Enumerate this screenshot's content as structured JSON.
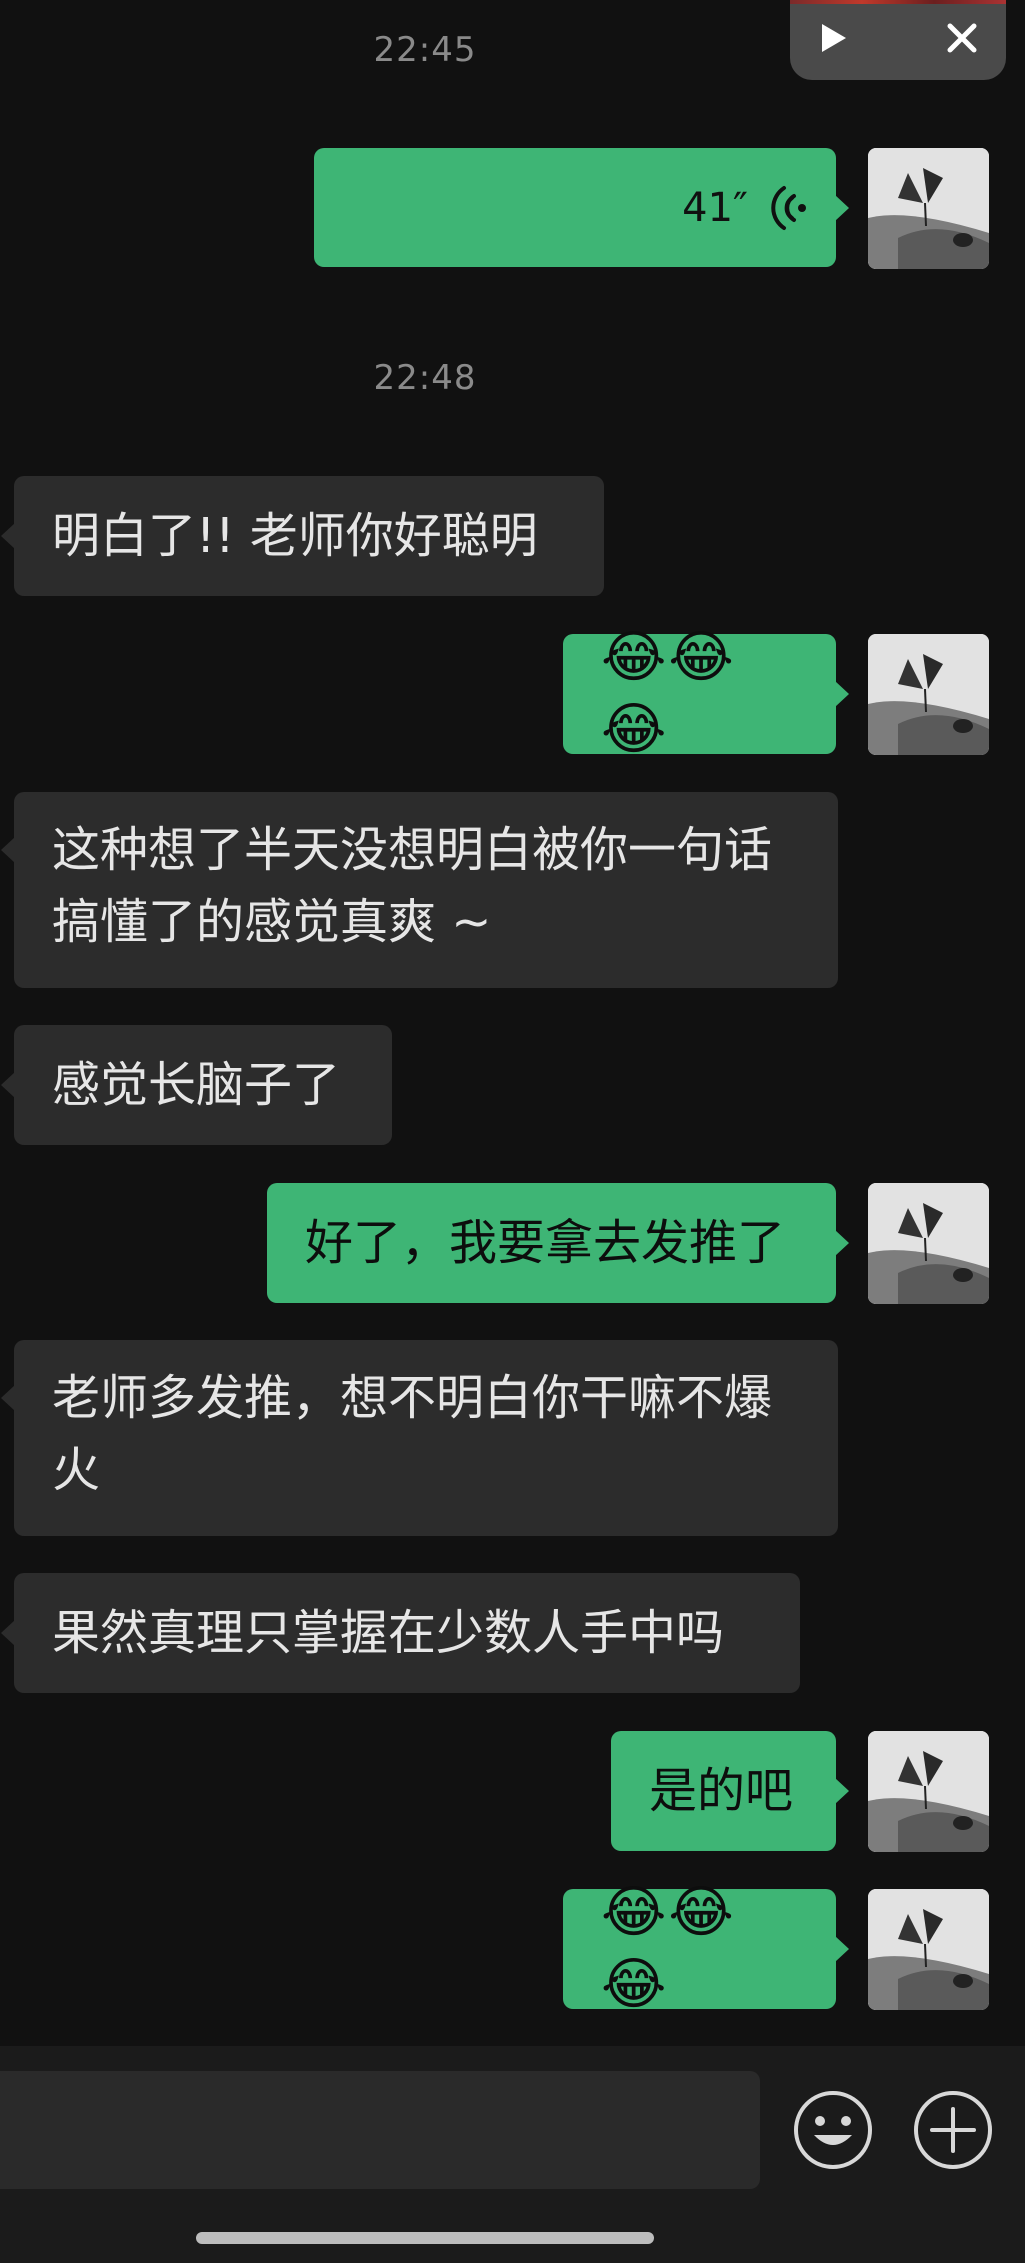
{
  "floating_window": {
    "play_icon": "play-icon",
    "close_icon": "close-icon"
  },
  "timestamps": [
    "22:45",
    "22:48"
  ],
  "messages": [
    {
      "side": "out",
      "type": "voice",
      "duration": "41″"
    },
    {
      "side": "in",
      "text": "明白了!! 老师你好聪明"
    },
    {
      "side": "out",
      "text": "😂😂😂"
    },
    {
      "side": "in",
      "text": "这种想了半天没想明白被你一句话搞懂了的感觉真爽 ~"
    },
    {
      "side": "in",
      "text": "感觉长脑子了"
    },
    {
      "side": "out",
      "text": "好了，我要拿去发推了"
    },
    {
      "side": "in",
      "text": "老师多发推，想不明白你干嘛不爆火"
    },
    {
      "side": "in",
      "text": "果然真理只掌握在少数人手中吗"
    },
    {
      "side": "out",
      "text": "是的吧"
    },
    {
      "side": "out",
      "text": "😂😂😂"
    }
  ],
  "avatar": {
    "icon": "cat-butterfly-avatar"
  },
  "bottom_bar": {
    "input_value": "",
    "emoji_icon": "emoji-icon",
    "plus_icon": "plus-icon"
  },
  "colors": {
    "background": "#111111",
    "incoming_bubble": "#2c2c2c",
    "outgoing_bubble": "#3eb575",
    "timestamp": "#8a8a8a"
  }
}
